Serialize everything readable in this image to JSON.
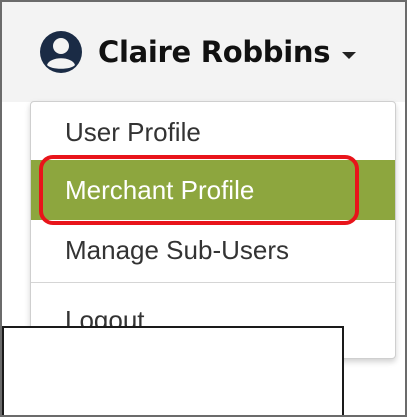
{
  "user_menu": {
    "user_name": "Claire Robbins",
    "avatar_icon": "user-circle-icon",
    "caret_icon": "caret-down-icon"
  },
  "menu": {
    "items": [
      {
        "label": "User Profile"
      },
      {
        "label": "Merchant Profile",
        "active": true
      },
      {
        "label": "Manage Sub-Users"
      },
      {
        "label": "Logout"
      }
    ]
  },
  "colors": {
    "active_background": "#8da63e",
    "highlight_ring": "#e8141a"
  }
}
